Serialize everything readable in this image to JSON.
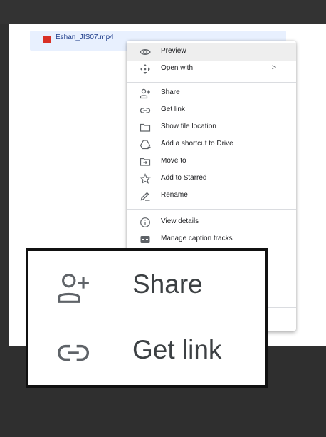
{
  "file": {
    "name": "Eshan_JIS07.mp4",
    "icon": "video-file-icon",
    "color": "#d93025"
  },
  "menu": {
    "items": [
      {
        "id": "preview",
        "label": "Preview",
        "icon": "eye-icon"
      },
      {
        "id": "open-with",
        "label": "Open with",
        "icon": "move-arrows-icon",
        "submenu": ">"
      },
      {
        "id": "share",
        "label": "Share",
        "icon": "person-add-icon"
      },
      {
        "id": "get-link",
        "label": "Get link",
        "icon": "link-icon"
      },
      {
        "id": "show-file-location",
        "label": "Show file location",
        "icon": "folder-icon"
      },
      {
        "id": "add-shortcut",
        "label": "Add a shortcut to Drive",
        "icon": "drive-shortcut-icon"
      },
      {
        "id": "move-to",
        "label": "Move to",
        "icon": "move-to-folder-icon"
      },
      {
        "id": "add-starred",
        "label": "Add to Starred",
        "icon": "star-icon"
      },
      {
        "id": "rename",
        "label": "Rename",
        "icon": "pencil-icon"
      },
      {
        "id": "view-details",
        "label": "View details",
        "icon": "info-icon"
      },
      {
        "id": "manage-captions",
        "label": "Manage caption tracks",
        "icon": "closed-caption-icon"
      }
    ]
  },
  "zoom": {
    "share_label": "Share",
    "get_link_label": "Get link"
  },
  "colors": {
    "selection": "#e8f0fe",
    "menu_hover": "#eeeeee",
    "text": "#202124",
    "icon": "#5f6368"
  }
}
